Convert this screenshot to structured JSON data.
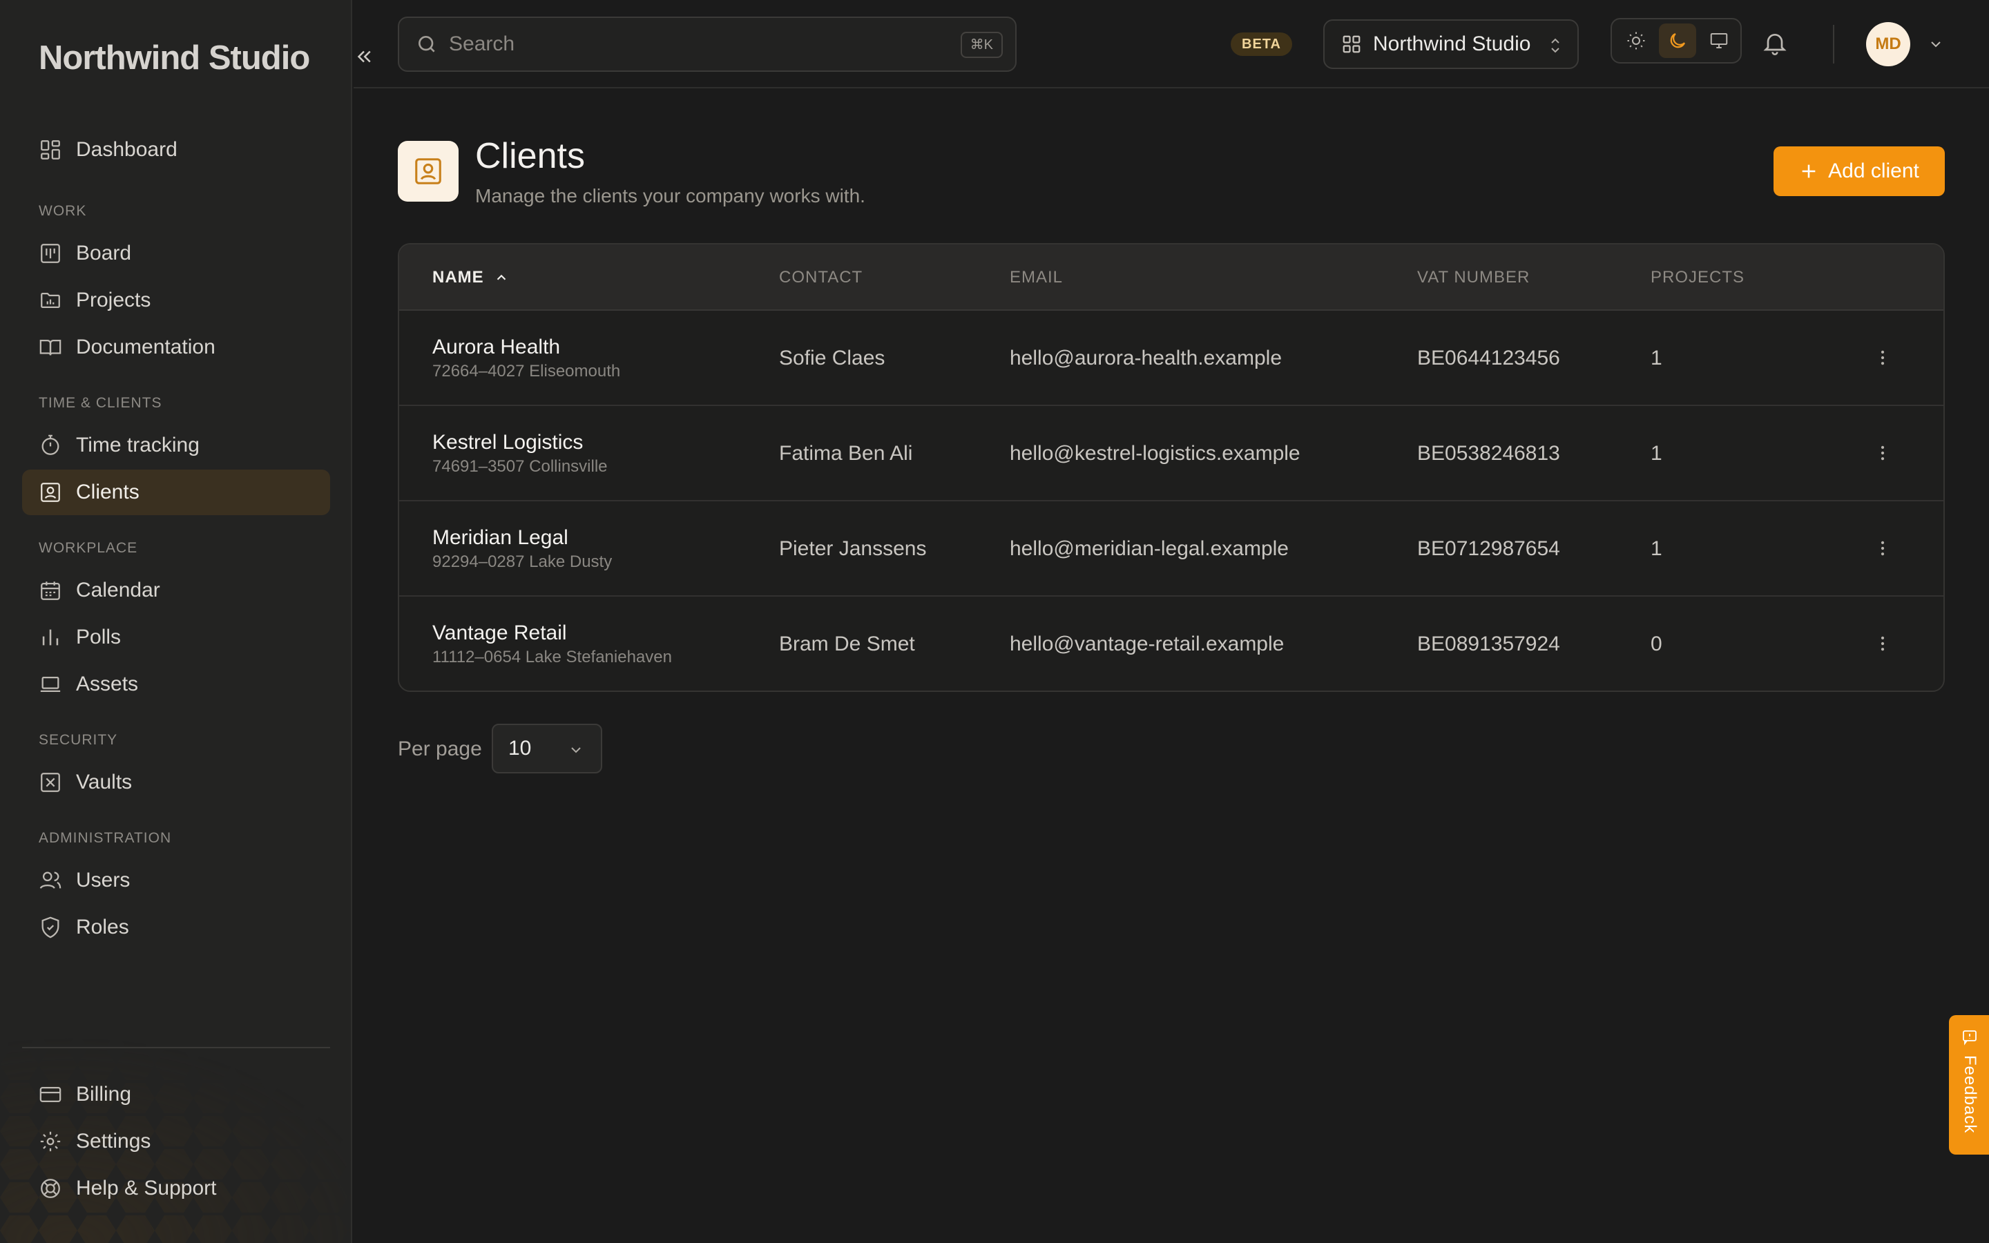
{
  "brand": {
    "name": "Northwind Studio"
  },
  "sidebar": {
    "items": [
      {
        "key": "dashboard",
        "label": "Dashboard",
        "icon": "dashboard-icon"
      },
      {
        "key": "board",
        "label": "Board",
        "icon": "kanban-board-icon",
        "section": "WORK"
      },
      {
        "key": "projects",
        "label": "Projects",
        "icon": "folder-chart-icon"
      },
      {
        "key": "documentation",
        "label": "Documentation",
        "icon": "book-icon"
      },
      {
        "key": "time-tracking",
        "label": "Time tracking",
        "icon": "stopwatch-icon",
        "section": "TIME & CLIENTS"
      },
      {
        "key": "clients",
        "label": "Clients",
        "icon": "contact-card-icon",
        "active": true
      },
      {
        "key": "calendar",
        "label": "Calendar",
        "icon": "calendar-icon",
        "section": "WORKPLACE"
      },
      {
        "key": "polls",
        "label": "Polls",
        "icon": "bar-chart-icon"
      },
      {
        "key": "assets",
        "label": "Assets",
        "icon": "laptop-icon"
      },
      {
        "key": "vaults",
        "label": "Vaults",
        "icon": "vault-icon",
        "section": "SECURITY"
      },
      {
        "key": "users",
        "label": "Users",
        "icon": "users-icon",
        "section": "ADMINISTRATION"
      },
      {
        "key": "roles",
        "label": "Roles",
        "icon": "shield-check-icon"
      }
    ],
    "sections": {
      "work": "WORK",
      "time_clients": "TIME & CLIENTS",
      "workplace": "WORKPLACE",
      "security": "SECURITY",
      "administration": "ADMINISTRATION"
    },
    "footer_items": [
      {
        "key": "billing",
        "label": "Billing",
        "icon": "credit-card-icon"
      },
      {
        "key": "settings",
        "label": "Settings",
        "icon": "gear-icon"
      },
      {
        "key": "help",
        "label": "Help & Support",
        "icon": "lifebuoy-icon"
      }
    ]
  },
  "topbar": {
    "search_placeholder": "Search",
    "search_shortcut": "⌘K",
    "beta_badge": "BETA",
    "org_name": "Northwind Studio",
    "theme": "dark",
    "avatar_initials": "MD"
  },
  "page": {
    "title": "Clients",
    "subtitle": "Manage the clients your company works with.",
    "add_button": "Add client"
  },
  "table": {
    "columns": [
      "NAME",
      "CONTACT",
      "EMAIL",
      "VAT NUMBER",
      "PROJECTS"
    ],
    "sort": {
      "column": "NAME",
      "direction": "ascending"
    },
    "rows": [
      {
        "name": "Aurora Health",
        "address": "72664–4027 Eliseomouth",
        "contact": "Sofie Claes",
        "email": "hello@aurora-health.example",
        "vat": "BE0644123456",
        "projects": "1"
      },
      {
        "name": "Kestrel Logistics",
        "address": "74691–3507 Collinsville",
        "contact": "Fatima Ben Ali",
        "email": "hello@kestrel-logistics.example",
        "vat": "BE0538246813",
        "projects": "1"
      },
      {
        "name": "Meridian Legal",
        "address": "92294–0287 Lake Dusty",
        "contact": "Pieter Janssens",
        "email": "hello@meridian-legal.example",
        "vat": "BE0712987654",
        "projects": "1"
      },
      {
        "name": "Vantage Retail",
        "address": "11112–0654 Lake Stefaniehaven",
        "contact": "Bram De Smet",
        "email": "hello@vantage-retail.example",
        "vat": "BE0891357924",
        "projects": "0"
      }
    ]
  },
  "pagination": {
    "per_page_label": "Per page",
    "per_page_value": "10"
  },
  "feedback_tab": {
    "label": "Feedback"
  },
  "colors": {
    "accent": "#f3930f",
    "active_nav_bg": "#3a3020",
    "background": "#1b1b1b",
    "sidebar_bg": "#232322"
  }
}
